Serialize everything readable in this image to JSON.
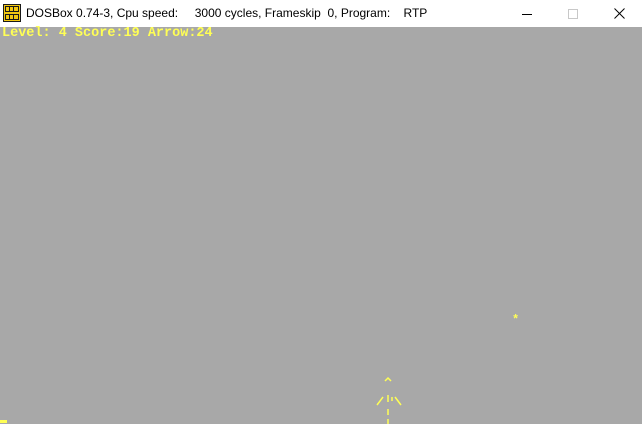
{
  "window": {
    "title": "DOSBox 0.74-3, Cpu speed:     3000 cycles, Frameskip  0, Program:    RTP",
    "controls": {
      "minimize_icon": "minimize-icon",
      "maximize_icon": "maximize-icon",
      "close_icon": "close-icon"
    }
  },
  "game": {
    "hud": "Level: 4 Score:19 Arrow:24",
    "target_glyph": "*",
    "colors": {
      "background": "#a8a8a8",
      "text": "#ffff55"
    }
  }
}
